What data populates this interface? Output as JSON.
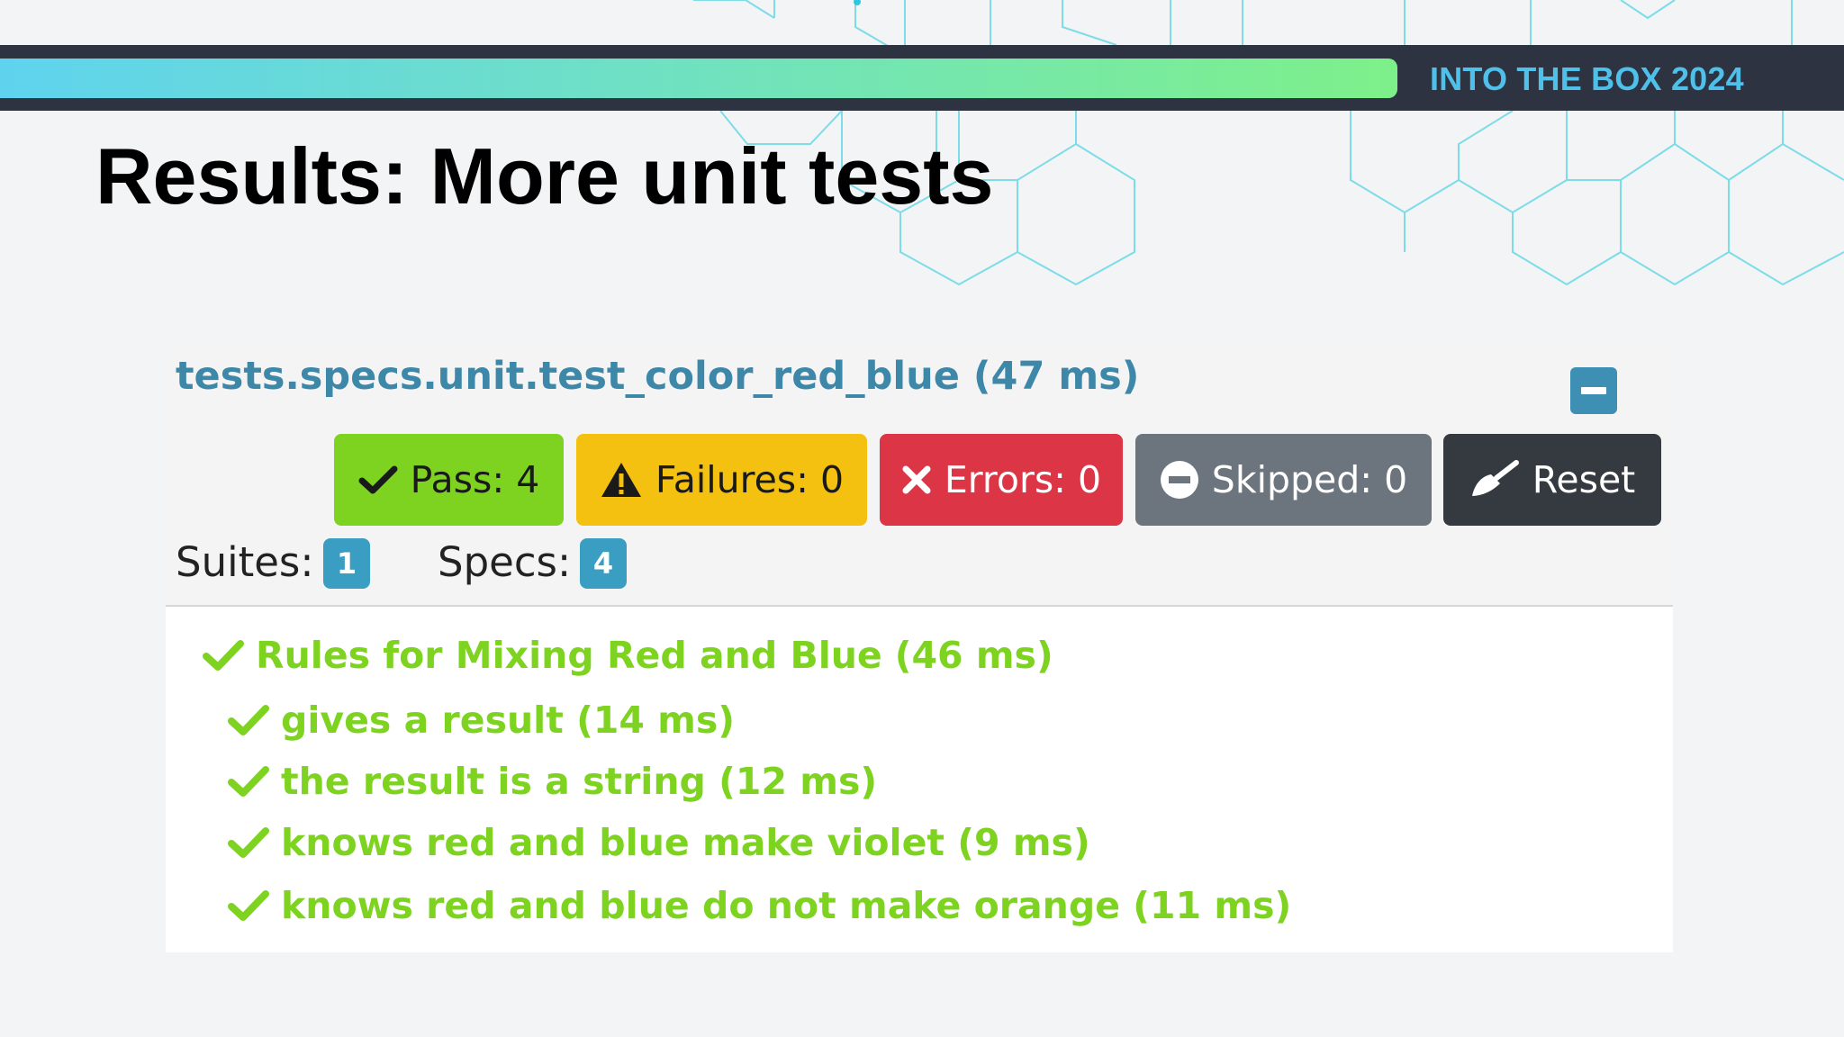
{
  "slide": {
    "brand": "INTO THE BOX 2024",
    "title": "Results: More unit tests"
  },
  "colors": {
    "bar": "#2d3340",
    "brand": "#4ec0ea",
    "pass": "#7ed321",
    "failures": "#f5c111",
    "errors": "#dc3545",
    "skipped": "#6c757d",
    "reset": "#343a40",
    "info": "#3d87a8"
  },
  "report": {
    "header": "tests.specs.unit.test_color_red_blue (47 ms)",
    "collapse_icon": "minus-square-icon",
    "buttons": {
      "pass": "Pass: 4",
      "failures": "Failures: 0",
      "errors": "Errors: 0",
      "skipped": "Skipped: 0",
      "reset": "Reset"
    },
    "button_icons": {
      "pass": "check-icon",
      "failures": "warning-icon",
      "errors": "x-icon",
      "skipped": "minus-circle-icon",
      "reset": "broom-icon"
    },
    "suites_label": "Suites:",
    "suites_count": "1",
    "specs_label": "Specs:",
    "specs_count": "4",
    "suite": {
      "name": "Rules for Mixing Red and Blue",
      "time": "(46 ms)",
      "specs": [
        {
          "text": "gives a result (14 ms)"
        },
        {
          "text": "the result is a string (12 ms)"
        },
        {
          "text": "knows red and blue make violet (9 ms)"
        },
        {
          "text": "knows red and blue do not make orange (11 ms)"
        }
      ]
    }
  }
}
